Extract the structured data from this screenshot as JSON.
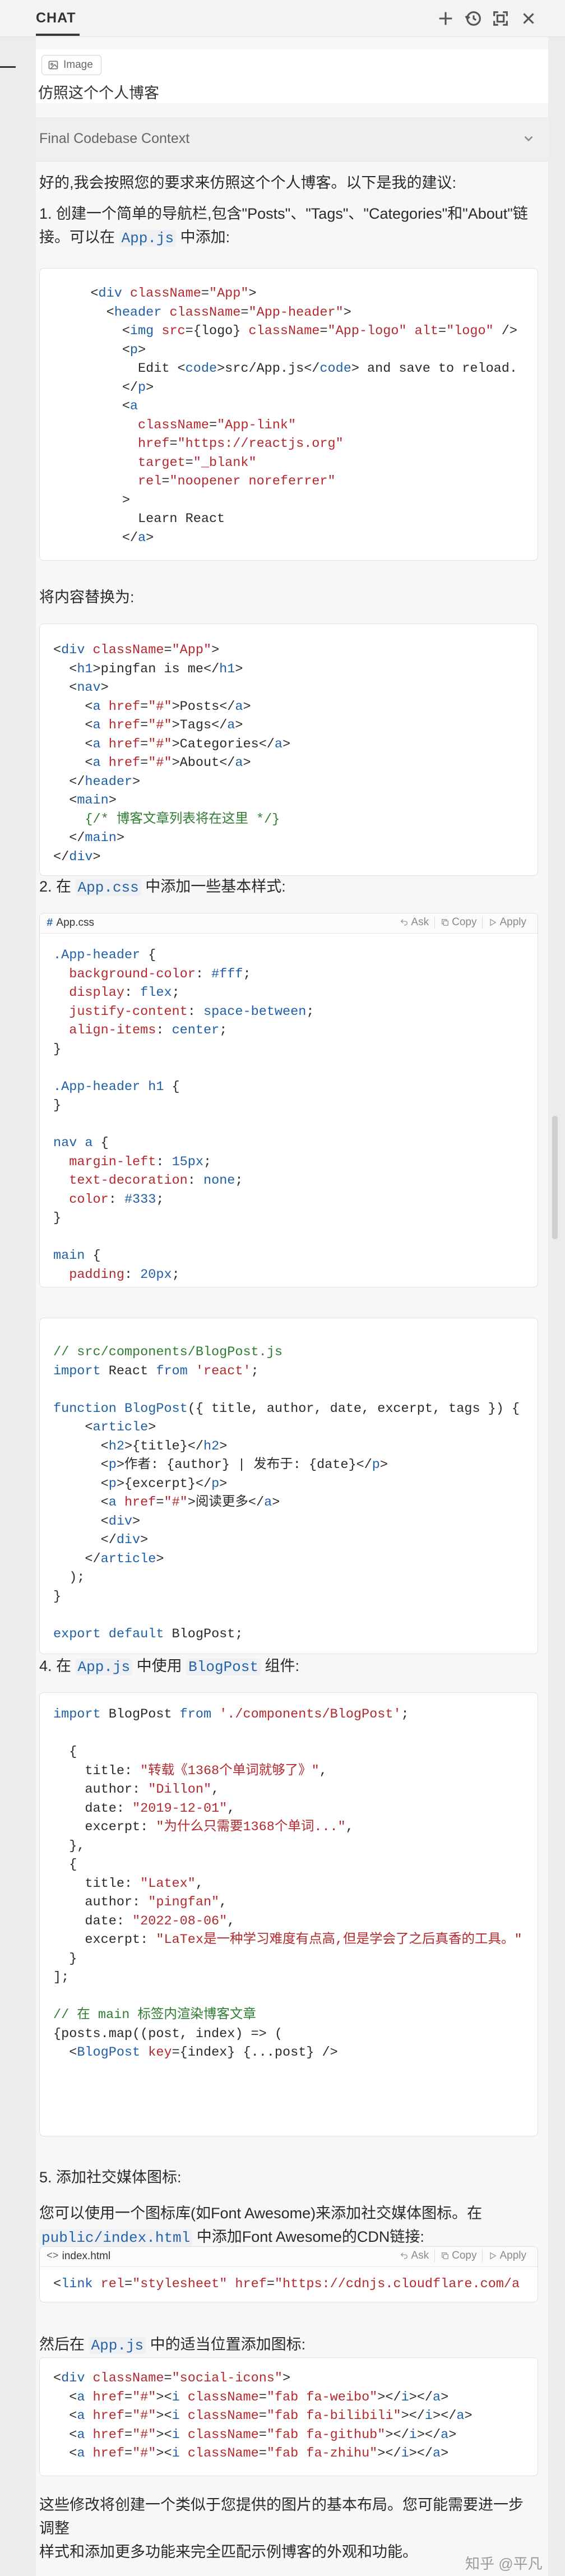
{
  "header": {
    "tab": "CHAT",
    "icons": [
      "plus-icon",
      "history-icon",
      "expand-icon",
      "close-icon"
    ]
  },
  "user_message": {
    "attachment_label": "Image",
    "text": "仿照这个个人博客"
  },
  "context": {
    "label": "Final Codebase Context"
  },
  "content": {
    "intro": "好的,我会按照您的要求来仿照这个个人博客。以下是我的建议:",
    "step1_a": "1. 创建一个简单的导航栏,包含\"Posts\"、\"Tags\"、\"Categories\"和\"About\"链",
    "step1_b_pre": "接。可以在 ",
    "step1_b_code": "App.js",
    "step1_b_post": " 中添加:",
    "replace_text": "将内容替换为:",
    "step2_pre": "2. 在 ",
    "step2_code": "App.css",
    "step2_post": " 中添加一些基本样式:",
    "step4_pre": "4. 在 ",
    "step4_code": "App.js",
    "step4_mid": " 中使用 ",
    "step4_code2": "BlogPost",
    "step4_post": " 组件:",
    "step5": "5. 添加社交媒体图标:",
    "step5_b": "您可以使用一个图标库(如Font Awesome)来添加社交媒体图标。在",
    "step5_c_code": "public/index.html",
    "step5_c_post": " 中添加Font Awesome的CDN链接:",
    "then_pre": "然后在 ",
    "then_code": "App.js",
    "then_post": " 中的适当位置添加图标:",
    "outro_a": "这些修改将创建一个类似于您提供的图片的基本布局。您可能需要进一步调整",
    "outro_b": "样式和添加更多功能来完全匹配示例博客的外观和功能。"
  },
  "code_actions": {
    "ask": "Ask",
    "copy": "Copy",
    "apply": "Apply"
  },
  "code_files": {
    "css": "App.css",
    "html": "index.html"
  },
  "watermark": "知乎 @平凡"
}
